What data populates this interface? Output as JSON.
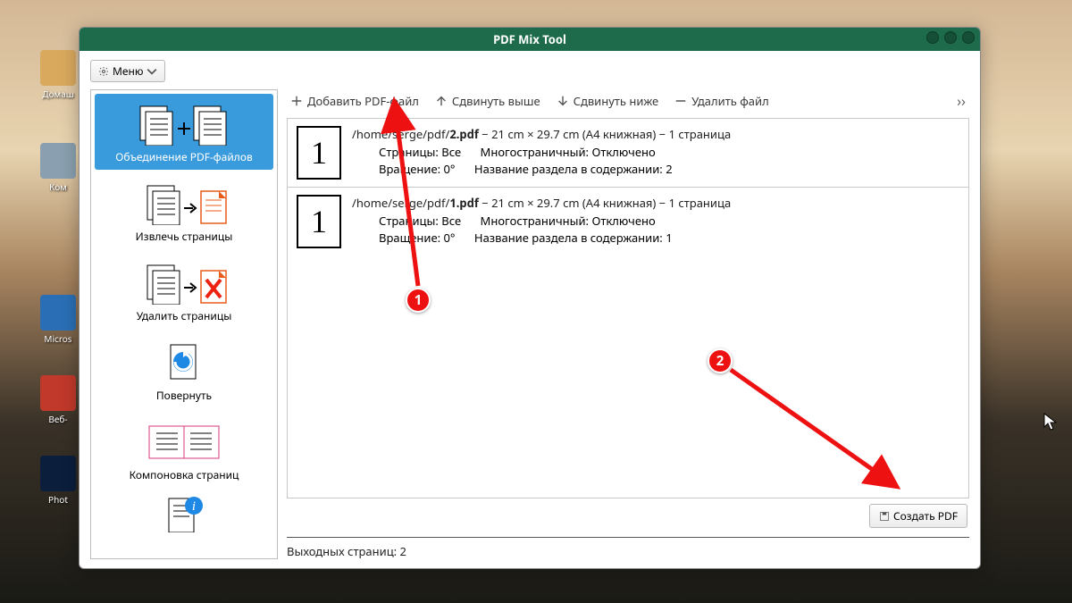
{
  "window": {
    "title": "PDF Mix Tool"
  },
  "desktop": {
    "home": "Домаш",
    "comp": "Ком",
    "micros": "Micros",
    "web": "Веб-",
    "photo": "Phot"
  },
  "menu": {
    "label": "Меню"
  },
  "sidebar": {
    "items": [
      {
        "label": "Объединение PDF-файлов"
      },
      {
        "label": "Извлечь страницы"
      },
      {
        "label": "Удалить страницы"
      },
      {
        "label": "Повернуть"
      },
      {
        "label": "Компоновка страниц"
      }
    ]
  },
  "toolbar": {
    "add": "Добавить PDF-файл",
    "up": "Сдвинуть выше",
    "down": "Сдвинуть ниже",
    "remove": "Удалить файл"
  },
  "files": [
    {
      "thumb": "1",
      "path_prefix": "/home/serge/pdf/",
      "path_bold": "2.pdf",
      "path_suffix": " − 21 cm × 29.7 cm (A4 книжная) − 1 страница",
      "pages_label": "Страницы:",
      "pages_value": "Все",
      "multi_label": "Многостраничный:",
      "multi_value": "Отключено",
      "rot_label": "Вращение:",
      "rot_value": "0°",
      "toc_label": "Название раздела в содержании:",
      "toc_value": "2"
    },
    {
      "thumb": "1",
      "path_prefix": "/home/serge/pdf/",
      "path_bold": "1.pdf",
      "path_suffix": " − 21 cm × 29.7 cm (A4 книжная) − 1 страница",
      "pages_label": "Страницы:",
      "pages_value": "Все",
      "multi_label": "Многостраничный:",
      "multi_value": "Отключено",
      "rot_label": "Вращение:",
      "rot_value": "0°",
      "toc_label": "Название раздела в содержании:",
      "toc_value": "1"
    }
  ],
  "create_btn": "Создать PDF",
  "status": "Выходных страниц: 2",
  "annotations": {
    "one": "1",
    "two": "2"
  }
}
